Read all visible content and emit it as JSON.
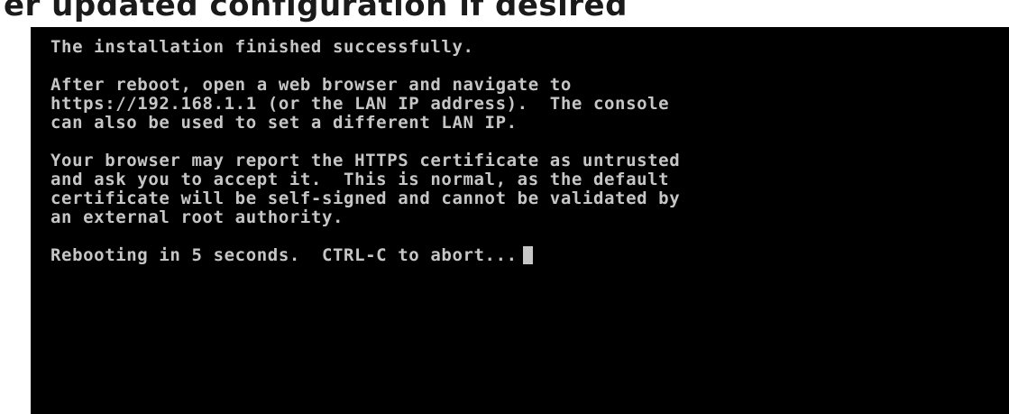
{
  "header": {
    "cropped_text": "er updated configuration if desired"
  },
  "console": {
    "lines": [
      "The installation finished successfully.",
      "",
      "After reboot, open a web browser and navigate to",
      "https://192.168.1.1 (or the LAN IP address).  The console",
      "can also be used to set a different LAN IP.",
      "",
      "Your browser may report the HTTPS certificate as untrusted",
      "and ask you to accept it.  This is normal, as the default",
      "certificate will be self-signed and cannot be validated by",
      "an external root authority.",
      "",
      "Rebooting in 5 seconds.  CTRL-C to abort..."
    ]
  },
  "colors": {
    "console_bg": "#000000",
    "console_fg": "#c6c6c6",
    "page_bg": "#ffffff"
  }
}
